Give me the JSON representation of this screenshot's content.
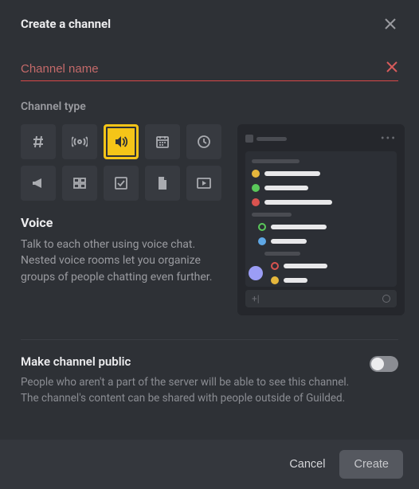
{
  "header": {
    "title": "Create a channel"
  },
  "nameInput": {
    "placeholder": "Channel name",
    "value": ""
  },
  "channelType": {
    "label": "Channel type",
    "selectedIndex": 2,
    "options": [
      {
        "id": "text",
        "icon": "hash-icon"
      },
      {
        "id": "announcements",
        "icon": "broadcast-icon"
      },
      {
        "id": "voice",
        "icon": "speaker-icon"
      },
      {
        "id": "calendar",
        "icon": "calendar-icon"
      },
      {
        "id": "scheduling",
        "icon": "clock-icon"
      },
      {
        "id": "announce2",
        "icon": "megaphone-icon"
      },
      {
        "id": "list",
        "icon": "list-icon"
      },
      {
        "id": "todo",
        "icon": "check-icon"
      },
      {
        "id": "docs",
        "icon": "doc-icon"
      },
      {
        "id": "media",
        "icon": "play-icon"
      }
    ],
    "selected": {
      "title": "Voice",
      "description": "Talk to each other using voice chat. Nested voice rooms let you organize groups of people chatting even further."
    }
  },
  "public": {
    "title": "Make channel public",
    "description": "People who aren't a part of the server will be able to see this channel. The channel's content can be shared with people outside of Guilded.",
    "enabled": false
  },
  "footer": {
    "cancel": "Cancel",
    "create": "Create"
  }
}
